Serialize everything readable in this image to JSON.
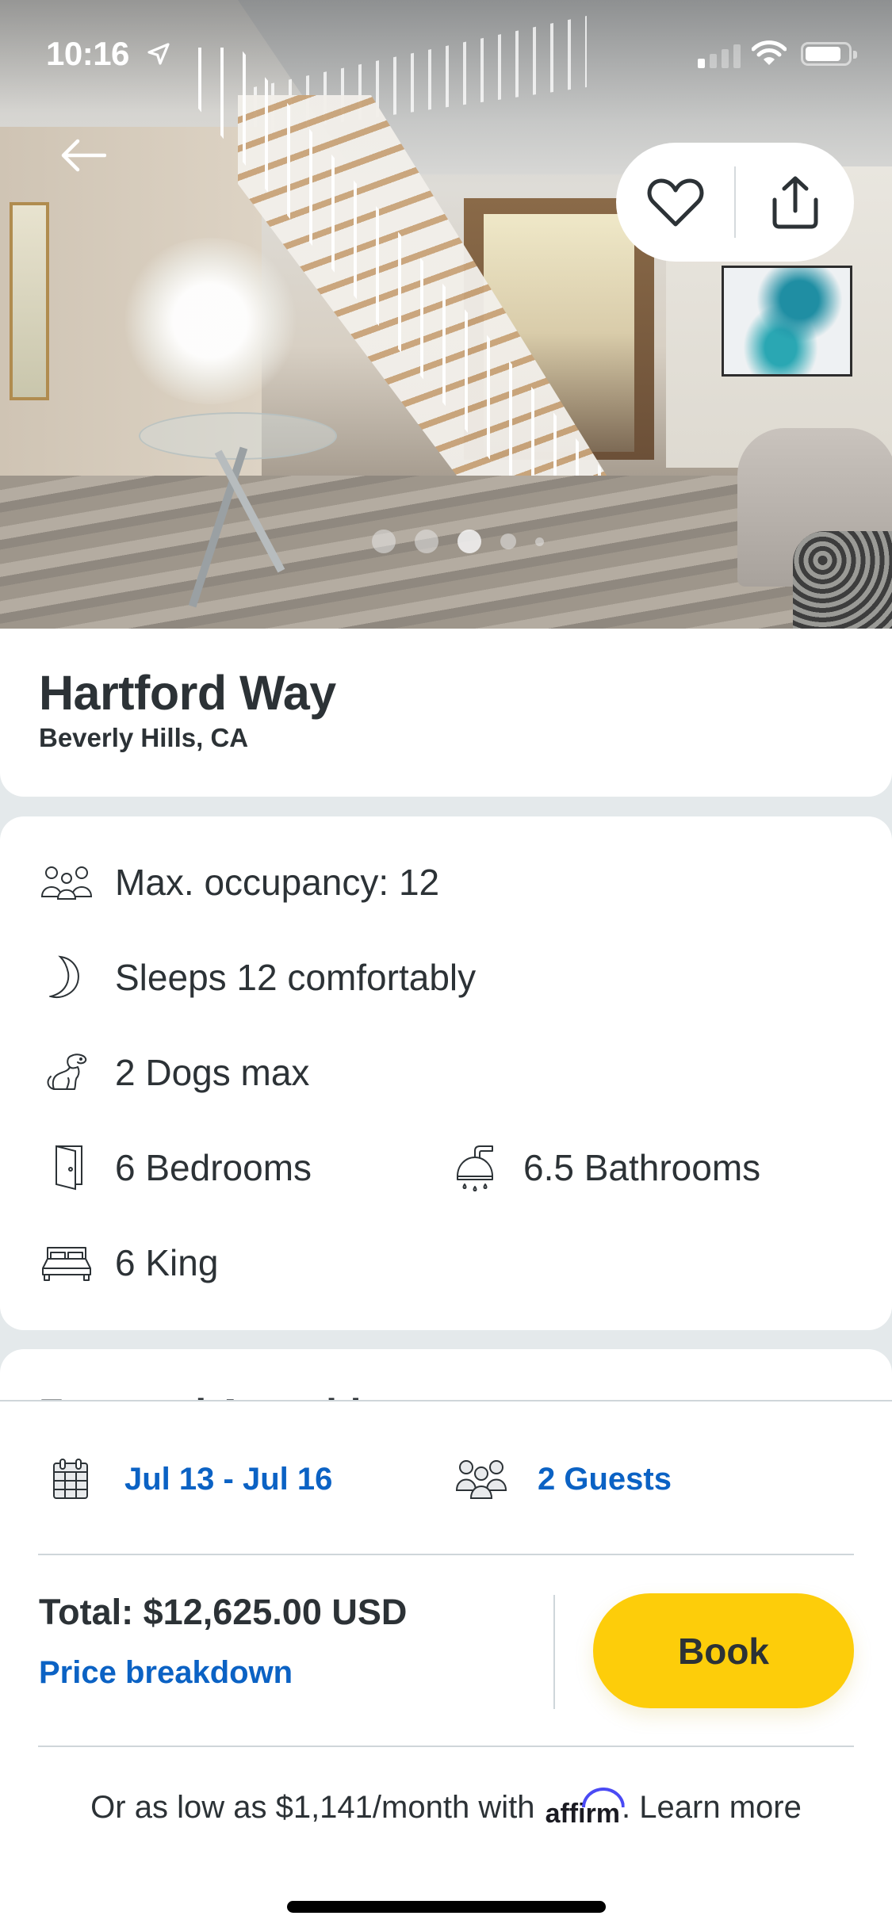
{
  "status_bar": {
    "time": "10:16",
    "location_icon": "location-arrow-icon",
    "signal_bars_active": 1,
    "signal_bars_total": 4,
    "wifi_icon": "wifi-icon",
    "battery_level_percent": 85
  },
  "header": {
    "back_icon": "arrow-left-icon",
    "favorite_icon": "heart-outline-icon",
    "share_icon": "share-icon"
  },
  "gallery": {
    "photo_description": "Entryway with white staircase, glass table with flowers, and armchair",
    "dot_count": 5,
    "active_dot_index": 2
  },
  "listing": {
    "title": "Hartford Way",
    "location": "Beverly Hills, CA"
  },
  "specs": [
    {
      "icon": "people-group-icon",
      "label": "Max. occupancy: 12"
    },
    {
      "icon": "moon-icon",
      "label": "Sleeps 12 comfortably"
    },
    {
      "icon": "dog-icon",
      "label": "2 Dogs max"
    },
    {
      "icon": "door-icon",
      "label": "6 Bedrooms"
    },
    {
      "icon": "shower-icon",
      "label": "6.5 Bathrooms"
    },
    {
      "icon": "bed-icon",
      "label": "6 King"
    }
  ],
  "next_section": {
    "heading": "Featured Amenities"
  },
  "booking": {
    "dates": "Jul 13 - Jul 16",
    "guests": "2 Guests",
    "total": "Total: $12,625.00 USD",
    "price_breakdown_label": "Price breakdown",
    "book_label": "Book",
    "affirm_prefix": "Or as low as $1,141/month with",
    "affirm_brand": "affirm",
    "affirm_suffix": ". Learn more"
  },
  "colors": {
    "text_primary": "#2c3236",
    "link_blue": "#0b62c4",
    "book_yellow": "#fdcd0a",
    "page_bg": "#e4e9eb",
    "divider": "#cfd6da",
    "affirm_purple": "#4a4af4"
  }
}
